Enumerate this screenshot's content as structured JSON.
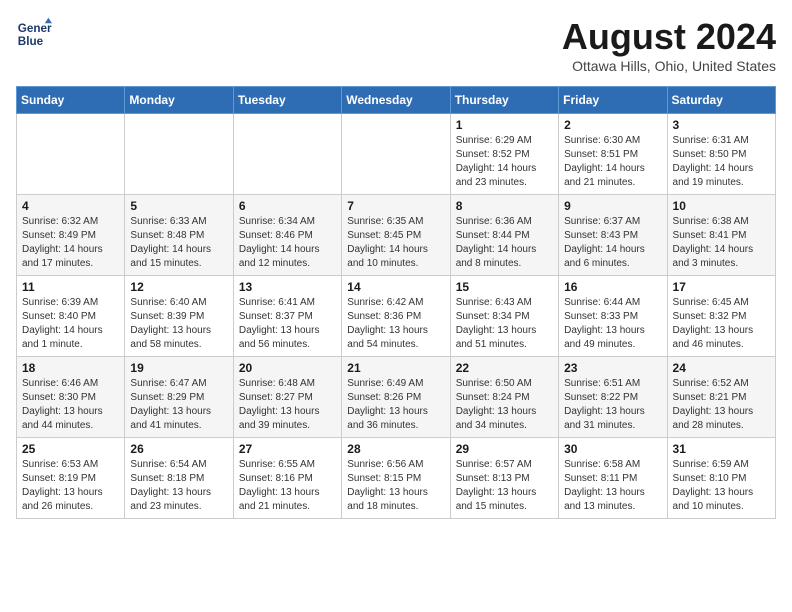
{
  "logo": {
    "line1": "General",
    "line2": "Blue"
  },
  "title": "August 2024",
  "location": "Ottawa Hills, Ohio, United States",
  "weekdays": [
    "Sunday",
    "Monday",
    "Tuesday",
    "Wednesday",
    "Thursday",
    "Friday",
    "Saturday"
  ],
  "weeks": [
    [
      {
        "day": "",
        "info": ""
      },
      {
        "day": "",
        "info": ""
      },
      {
        "day": "",
        "info": ""
      },
      {
        "day": "",
        "info": ""
      },
      {
        "day": "1",
        "info": "Sunrise: 6:29 AM\nSunset: 8:52 PM\nDaylight: 14 hours\nand 23 minutes."
      },
      {
        "day": "2",
        "info": "Sunrise: 6:30 AM\nSunset: 8:51 PM\nDaylight: 14 hours\nand 21 minutes."
      },
      {
        "day": "3",
        "info": "Sunrise: 6:31 AM\nSunset: 8:50 PM\nDaylight: 14 hours\nand 19 minutes."
      }
    ],
    [
      {
        "day": "4",
        "info": "Sunrise: 6:32 AM\nSunset: 8:49 PM\nDaylight: 14 hours\nand 17 minutes."
      },
      {
        "day": "5",
        "info": "Sunrise: 6:33 AM\nSunset: 8:48 PM\nDaylight: 14 hours\nand 15 minutes."
      },
      {
        "day": "6",
        "info": "Sunrise: 6:34 AM\nSunset: 8:46 PM\nDaylight: 14 hours\nand 12 minutes."
      },
      {
        "day": "7",
        "info": "Sunrise: 6:35 AM\nSunset: 8:45 PM\nDaylight: 14 hours\nand 10 minutes."
      },
      {
        "day": "8",
        "info": "Sunrise: 6:36 AM\nSunset: 8:44 PM\nDaylight: 14 hours\nand 8 minutes."
      },
      {
        "day": "9",
        "info": "Sunrise: 6:37 AM\nSunset: 8:43 PM\nDaylight: 14 hours\nand 6 minutes."
      },
      {
        "day": "10",
        "info": "Sunrise: 6:38 AM\nSunset: 8:41 PM\nDaylight: 14 hours\nand 3 minutes."
      }
    ],
    [
      {
        "day": "11",
        "info": "Sunrise: 6:39 AM\nSunset: 8:40 PM\nDaylight: 14 hours\nand 1 minute."
      },
      {
        "day": "12",
        "info": "Sunrise: 6:40 AM\nSunset: 8:39 PM\nDaylight: 13 hours\nand 58 minutes."
      },
      {
        "day": "13",
        "info": "Sunrise: 6:41 AM\nSunset: 8:37 PM\nDaylight: 13 hours\nand 56 minutes."
      },
      {
        "day": "14",
        "info": "Sunrise: 6:42 AM\nSunset: 8:36 PM\nDaylight: 13 hours\nand 54 minutes."
      },
      {
        "day": "15",
        "info": "Sunrise: 6:43 AM\nSunset: 8:34 PM\nDaylight: 13 hours\nand 51 minutes."
      },
      {
        "day": "16",
        "info": "Sunrise: 6:44 AM\nSunset: 8:33 PM\nDaylight: 13 hours\nand 49 minutes."
      },
      {
        "day": "17",
        "info": "Sunrise: 6:45 AM\nSunset: 8:32 PM\nDaylight: 13 hours\nand 46 minutes."
      }
    ],
    [
      {
        "day": "18",
        "info": "Sunrise: 6:46 AM\nSunset: 8:30 PM\nDaylight: 13 hours\nand 44 minutes."
      },
      {
        "day": "19",
        "info": "Sunrise: 6:47 AM\nSunset: 8:29 PM\nDaylight: 13 hours\nand 41 minutes."
      },
      {
        "day": "20",
        "info": "Sunrise: 6:48 AM\nSunset: 8:27 PM\nDaylight: 13 hours\nand 39 minutes."
      },
      {
        "day": "21",
        "info": "Sunrise: 6:49 AM\nSunset: 8:26 PM\nDaylight: 13 hours\nand 36 minutes."
      },
      {
        "day": "22",
        "info": "Sunrise: 6:50 AM\nSunset: 8:24 PM\nDaylight: 13 hours\nand 34 minutes."
      },
      {
        "day": "23",
        "info": "Sunrise: 6:51 AM\nSunset: 8:22 PM\nDaylight: 13 hours\nand 31 minutes."
      },
      {
        "day": "24",
        "info": "Sunrise: 6:52 AM\nSunset: 8:21 PM\nDaylight: 13 hours\nand 28 minutes."
      }
    ],
    [
      {
        "day": "25",
        "info": "Sunrise: 6:53 AM\nSunset: 8:19 PM\nDaylight: 13 hours\nand 26 minutes."
      },
      {
        "day": "26",
        "info": "Sunrise: 6:54 AM\nSunset: 8:18 PM\nDaylight: 13 hours\nand 23 minutes."
      },
      {
        "day": "27",
        "info": "Sunrise: 6:55 AM\nSunset: 8:16 PM\nDaylight: 13 hours\nand 21 minutes."
      },
      {
        "day": "28",
        "info": "Sunrise: 6:56 AM\nSunset: 8:15 PM\nDaylight: 13 hours\nand 18 minutes."
      },
      {
        "day": "29",
        "info": "Sunrise: 6:57 AM\nSunset: 8:13 PM\nDaylight: 13 hours\nand 15 minutes."
      },
      {
        "day": "30",
        "info": "Sunrise: 6:58 AM\nSunset: 8:11 PM\nDaylight: 13 hours\nand 13 minutes."
      },
      {
        "day": "31",
        "info": "Sunrise: 6:59 AM\nSunset: 8:10 PM\nDaylight: 13 hours\nand 10 minutes."
      }
    ]
  ]
}
